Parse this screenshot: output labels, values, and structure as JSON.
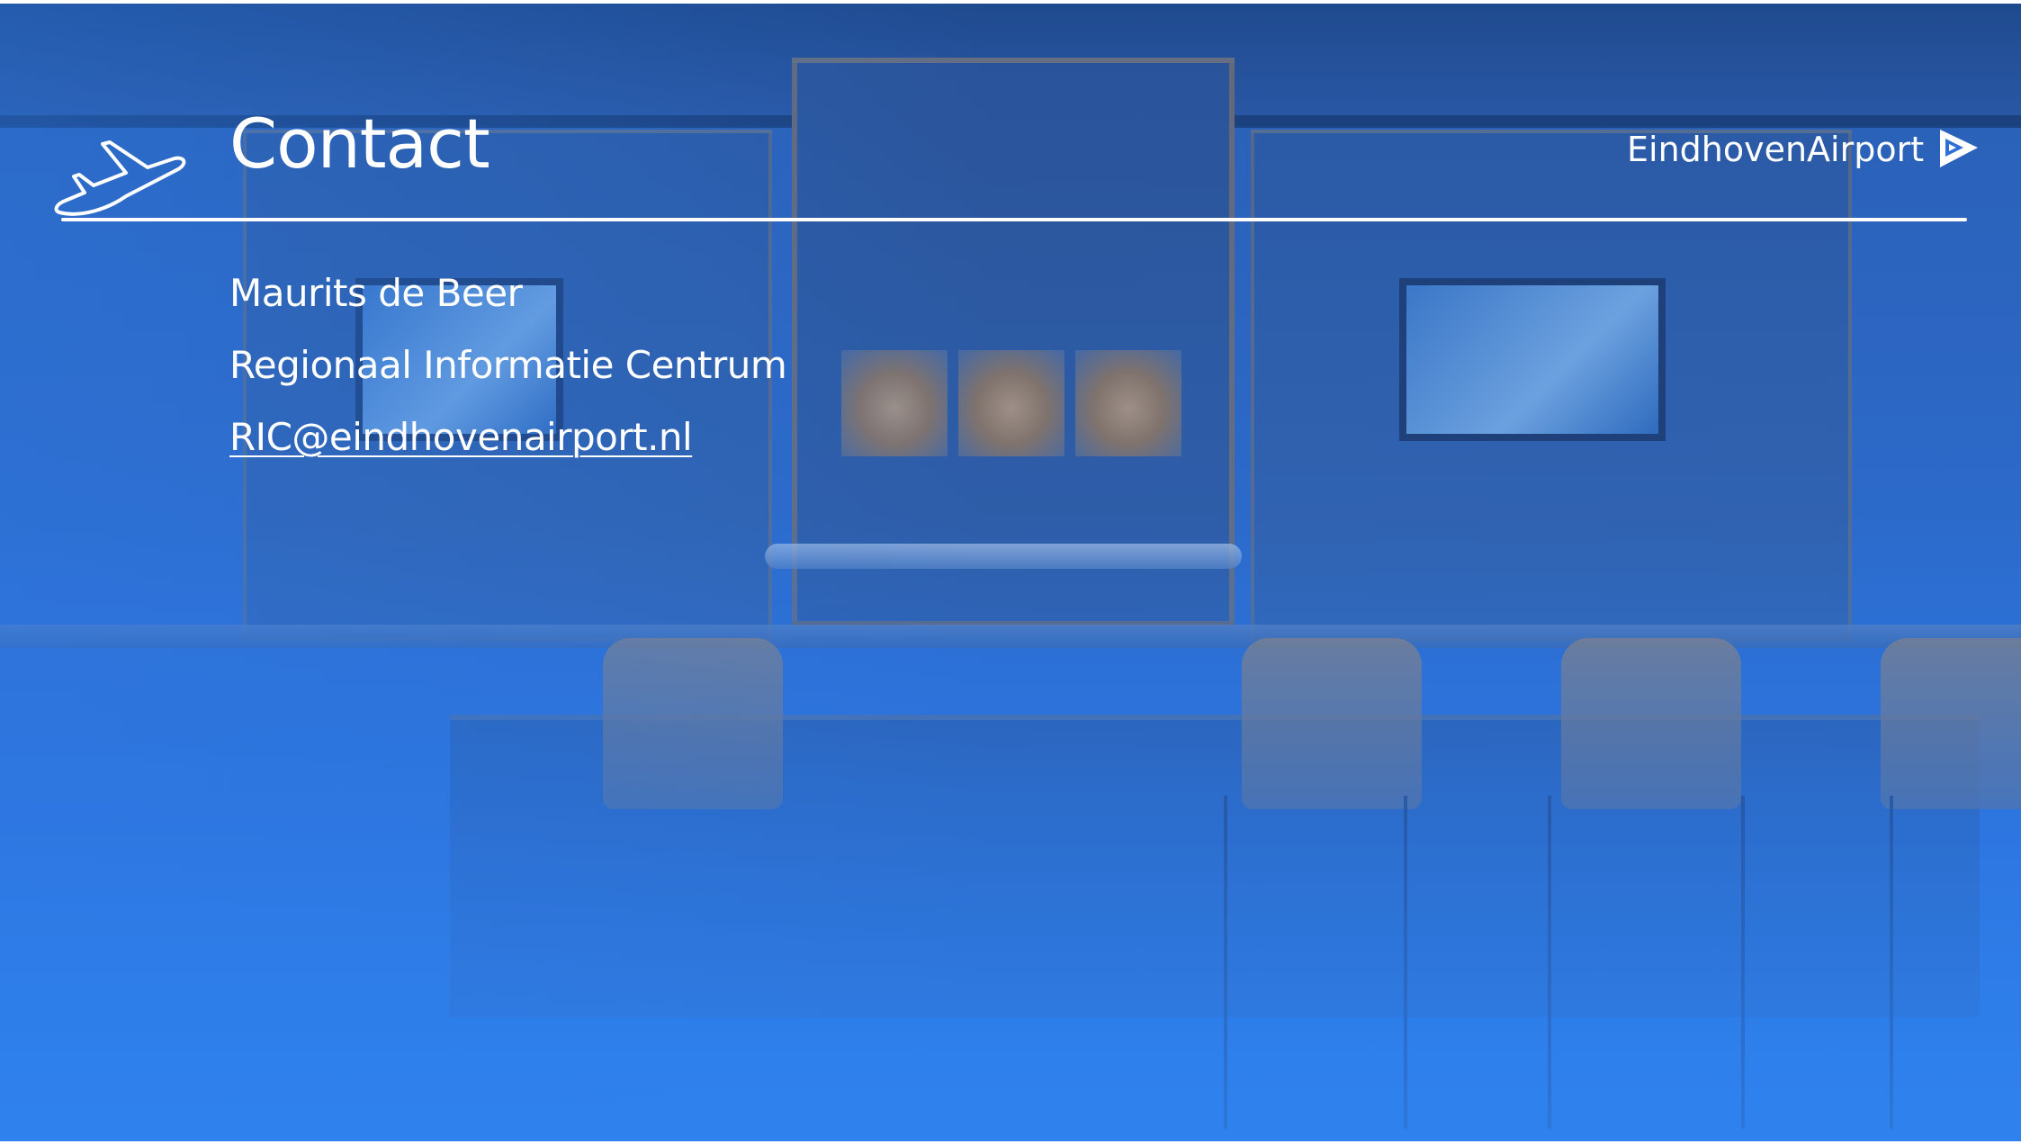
{
  "slide": {
    "title": "Contact",
    "contact": {
      "name": "Maurits de Beer",
      "organization": "Regionaal Informatie Centrum",
      "email": "RIC@eindhovenairport.nl"
    },
    "logo": {
      "text": "EindhovenAirport"
    }
  },
  "icons": {
    "title_icon": "airplane-takeoff-icon",
    "logo_mark": "flag-arrow-logo-icon"
  },
  "colors": {
    "background_blue": "#2d75df",
    "text": "#ffffff"
  }
}
